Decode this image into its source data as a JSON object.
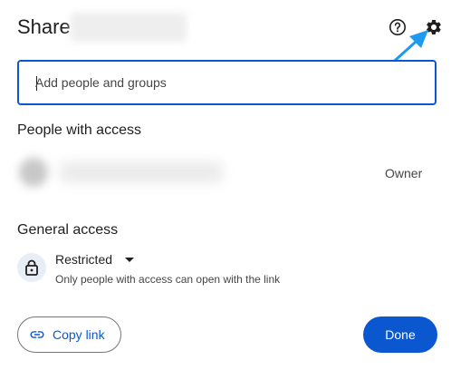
{
  "dialog": {
    "title": "Share",
    "help_icon": "help-circle-icon",
    "settings_icon": "gear-icon"
  },
  "add_people": {
    "placeholder": "Add people and groups"
  },
  "people_with_access": {
    "heading": "People with access",
    "entries": [
      {
        "name": "",
        "role": "Owner"
      }
    ]
  },
  "general_access": {
    "heading": "General access",
    "icon": "lock-icon",
    "level": "Restricted",
    "description": "Only people with access can open with the link"
  },
  "footer": {
    "copy_link_label": "Copy link",
    "copy_link_icon": "link-icon",
    "done_label": "Done"
  },
  "colors": {
    "accent": "#0b57d0",
    "annotation_arrow": "#1e9bf0"
  }
}
